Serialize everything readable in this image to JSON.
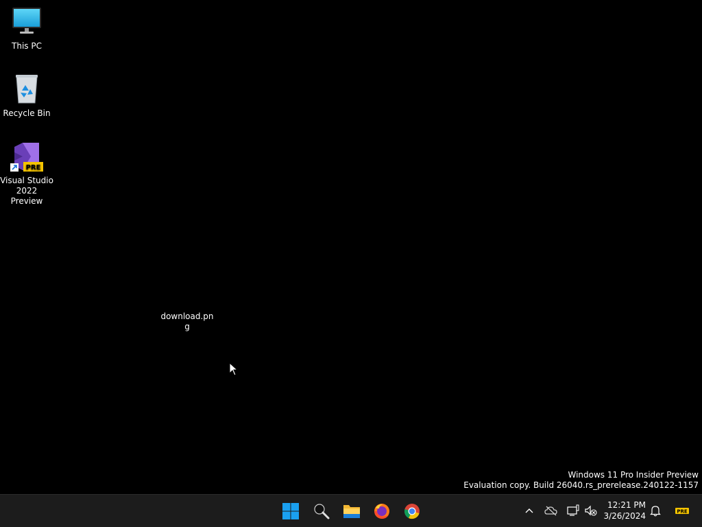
{
  "desktop": {
    "icons": [
      {
        "label": "This PC",
        "icon": "monitor-icon"
      },
      {
        "label": "Recycle Bin",
        "icon": "recycle-bin-icon"
      },
      {
        "label": "Visual Studio 2022 Preview",
        "icon": "visual-studio-icon",
        "badge": "PRE"
      },
      {
        "label": "download.pn\ng",
        "icon": "image-file-icon"
      }
    ]
  },
  "watermark": {
    "line1": "Windows 11 Pro Insider Preview",
    "line2": "Evaluation copy. Build 26040.rs_prerelease.240122-1157"
  },
  "taskbar": {
    "apps": [
      {
        "name": "Start",
        "icon": "windows-logo-icon"
      },
      {
        "name": "Search",
        "icon": "search-icon"
      },
      {
        "name": "File Explorer",
        "icon": "folder-icon"
      },
      {
        "name": "Firefox",
        "icon": "firefox-icon"
      },
      {
        "name": "Chrome",
        "icon": "chrome-icon"
      }
    ],
    "tray": {
      "icons": [
        "chevron-up-icon",
        "onedrive-icon",
        "network-icon",
        "volume-muted-icon",
        "bell-icon"
      ],
      "pre_badge": "PRE"
    },
    "clock": {
      "time": "12:21 PM",
      "date": "3/26/2024"
    }
  },
  "colors": {
    "desktop_bg": "#000000",
    "taskbar_bg": "#1c1c1c",
    "windows_blue": "#1aa0f0",
    "vs_purple": "#8a5cd6",
    "pre_yellow": "#f5c400"
  }
}
